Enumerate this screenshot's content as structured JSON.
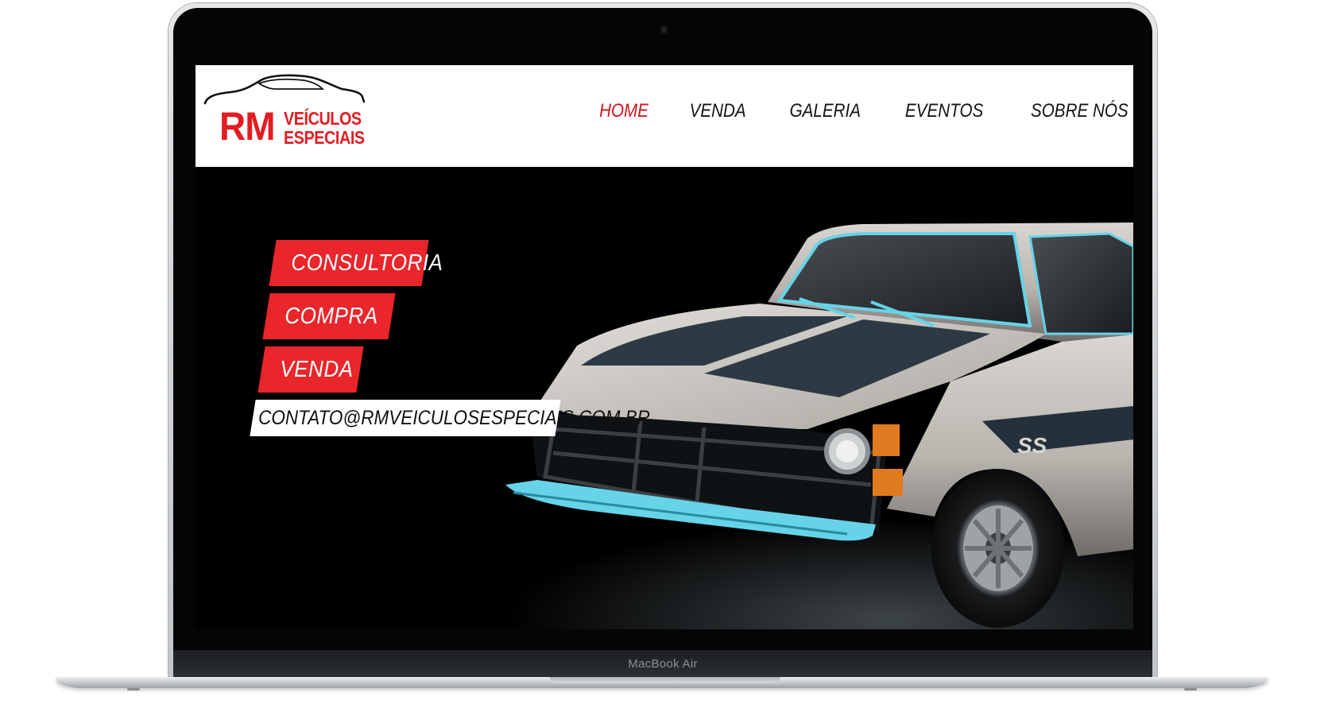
{
  "device": {
    "label": "MacBook Air"
  },
  "brand": {
    "rm": "RM",
    "line1": "VEÍCULOS",
    "line2": "ESPECIAIS"
  },
  "nav": {
    "items": [
      {
        "label": "HOME",
        "active": true
      },
      {
        "label": "VENDA",
        "active": false
      },
      {
        "label": "GALERIA",
        "active": false
      },
      {
        "label": "EVENTOS",
        "active": false
      },
      {
        "label": "SOBRE NÓS",
        "active": false
      }
    ]
  },
  "hero": {
    "buttons": [
      "CONSULTORIA",
      "COMPRA",
      "VENDA"
    ],
    "email": "CONTATO@RMVEICULOSESPECIAIS.COM.BR",
    "car_badge": "SS"
  },
  "colors": {
    "accent": "#e8262b",
    "nav_active": "#d0161d",
    "background": "#000000"
  }
}
